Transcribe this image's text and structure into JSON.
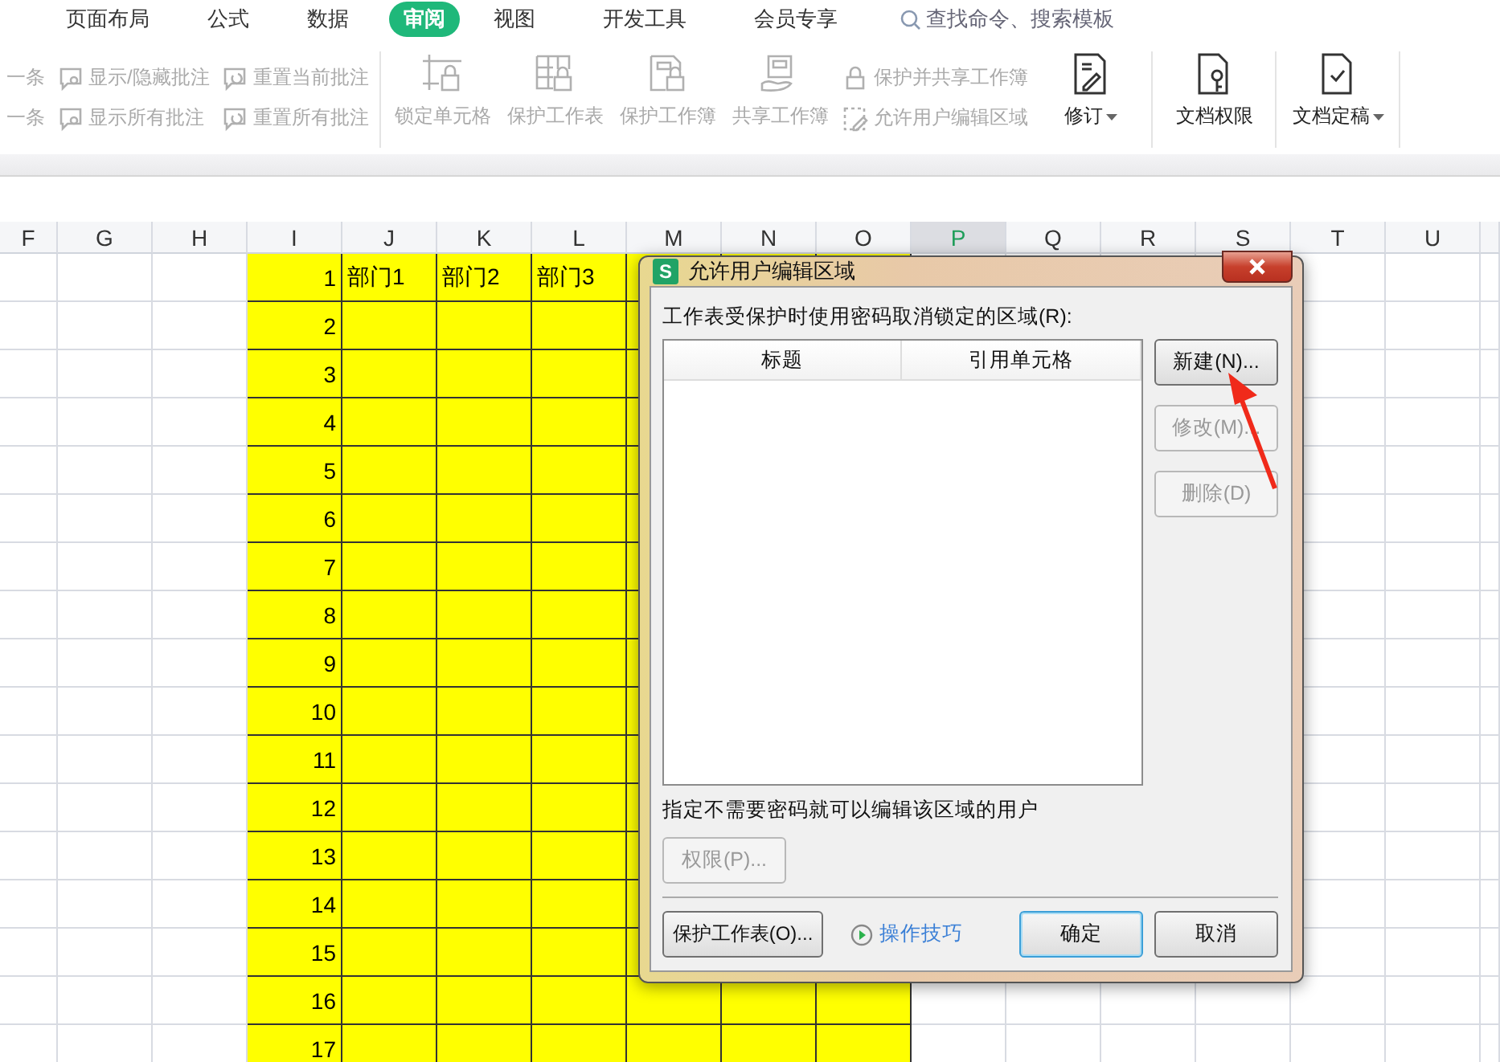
{
  "menu_tabs": [
    {
      "label": "页面布局",
      "selected": false
    },
    {
      "label": "公式",
      "selected": false
    },
    {
      "label": "数据",
      "selected": false
    },
    {
      "label": "审阅",
      "selected": true
    },
    {
      "label": "视图",
      "selected": false
    },
    {
      "label": "开发工具",
      "selected": false
    },
    {
      "label": "会员专享",
      "selected": false
    }
  ],
  "search": {
    "placeholder": "查找命令、搜索模板"
  },
  "ribbon": [
    {
      "kind": "stack",
      "items": [
        {
          "label": "一条",
          "disabled": true
        },
        {
          "label": "一条",
          "disabled": true
        }
      ]
    },
    {
      "kind": "stack",
      "items": [
        {
          "label": "显示/隐藏批注",
          "disabled": true
        },
        {
          "label": "显示所有批注",
          "disabled": true
        }
      ]
    },
    {
      "kind": "stack",
      "items": [
        {
          "label": "重置当前批注",
          "disabled": true
        },
        {
          "label": "重置所有批注",
          "disabled": true
        }
      ]
    },
    {
      "kind": "divider"
    },
    {
      "kind": "large",
      "label": "锁定单元格",
      "disabled": true,
      "dropdown": false
    },
    {
      "kind": "large",
      "label": "保护工作表",
      "disabled": true,
      "dropdown": false
    },
    {
      "kind": "large",
      "label": "保护工作簿",
      "disabled": true,
      "dropdown": false
    },
    {
      "kind": "large",
      "label": "共享工作簿",
      "disabled": true,
      "dropdown": false
    },
    {
      "kind": "stack",
      "items": [
        {
          "label": "保护并共享工作簿",
          "disabled": true
        },
        {
          "label": "允许用户编辑区域",
          "disabled": true
        }
      ]
    },
    {
      "kind": "large",
      "label": "修订",
      "disabled": false,
      "dropdown": true
    },
    {
      "kind": "divider"
    },
    {
      "kind": "large",
      "label": "文档权限",
      "disabled": false,
      "dropdown": false
    },
    {
      "kind": "divider"
    },
    {
      "kind": "large",
      "label": "文档定稿",
      "disabled": false,
      "dropdown": true
    },
    {
      "kind": "divider"
    }
  ],
  "sheet": {
    "columns": [
      {
        "label": "F",
        "selected": false,
        "filled": false
      },
      {
        "label": "G",
        "selected": false,
        "filled": false
      },
      {
        "label": "H",
        "selected": false,
        "filled": false
      },
      {
        "label": "I",
        "selected": false,
        "filled": true
      },
      {
        "label": "J",
        "selected": false,
        "filled": true
      },
      {
        "label": "K",
        "selected": false,
        "filled": true
      },
      {
        "label": "L",
        "selected": false,
        "filled": true
      },
      {
        "label": "M",
        "selected": false,
        "filled": true
      },
      {
        "label": "N",
        "selected": false,
        "filled": true
      },
      {
        "label": "O",
        "selected": false,
        "filled": true
      },
      {
        "label": "P",
        "selected": true,
        "filled": false
      },
      {
        "label": "Q",
        "selected": false,
        "filled": false
      },
      {
        "label": "R",
        "selected": false,
        "filled": false
      },
      {
        "label": "S",
        "selected": false,
        "filled": false
      },
      {
        "label": "T",
        "selected": false,
        "filled": false
      },
      {
        "label": "U",
        "selected": false,
        "filled": false
      }
    ],
    "rows": [
      {
        "number": "1",
        "labels": [
          "部门1",
          "部门2",
          "部门3"
        ]
      },
      {
        "number": "2"
      },
      {
        "number": "3"
      },
      {
        "number": "4"
      },
      {
        "number": "5"
      },
      {
        "number": "6"
      },
      {
        "number": "7"
      },
      {
        "number": "8"
      },
      {
        "number": "9"
      },
      {
        "number": "10"
      },
      {
        "number": "11"
      },
      {
        "number": "12"
      },
      {
        "number": "13"
      },
      {
        "number": "14"
      },
      {
        "number": "15"
      },
      {
        "number": "16"
      },
      {
        "number": "17"
      }
    ]
  },
  "dialog": {
    "badge": "S",
    "title": "允许用户编辑区域",
    "prompt": "工作表受保护时使用密码取消锁定的区域(R):",
    "list_columns": [
      "标题",
      "引用单元格"
    ],
    "side_buttons": [
      {
        "label": "新建(N)...",
        "disabled": false
      },
      {
        "label": "修改(M)...",
        "disabled": true
      },
      {
        "label": "删除(D)",
        "disabled": true
      }
    ],
    "users_label": "指定不需要密码就可以编辑该区域的用户",
    "permissions_button": {
      "label": "权限(P)...",
      "disabled": true
    },
    "protect_button": "保护工作表(O)...",
    "tips_link": "操作技巧",
    "ok_button": "确定",
    "cancel_button": "取消"
  }
}
